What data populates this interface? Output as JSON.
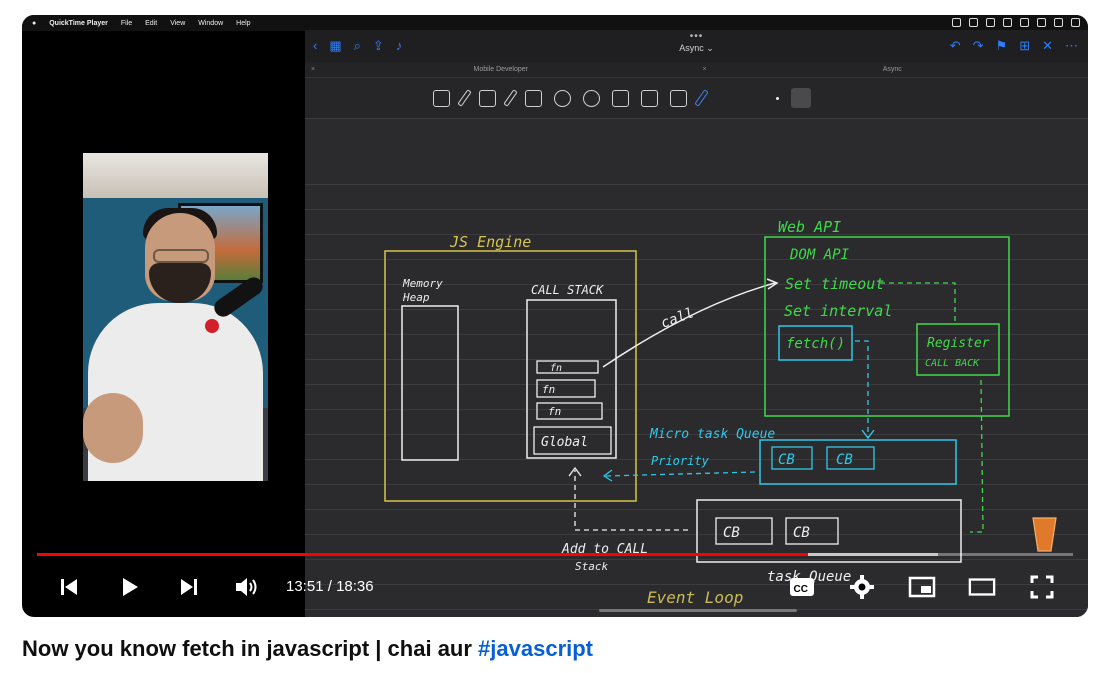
{
  "menubar": {
    "app_name": "QuickTime Player",
    "items": [
      "File",
      "Edit",
      "View",
      "Window",
      "Help"
    ]
  },
  "ipad": {
    "doc_title": "Async ⌄",
    "tabs": [
      "Mobile Developer",
      "Async"
    ]
  },
  "diagram": {
    "js_engine": "JS Engine",
    "memory_heap": [
      "Memory",
      "Heap"
    ],
    "call_stack": "CALL STACK",
    "stack_items": [
      "fn",
      "fn",
      "fn",
      "Global"
    ],
    "call_label": "call",
    "web_api": "Web API",
    "dom_api": "DOM API",
    "set_timeout": "Set timeout",
    "set_interval": "Set interval",
    "fetch": "fetch()",
    "register": [
      "Register",
      "CALL BACK"
    ],
    "micro_queue": "Micro task Queue",
    "priority": "Priority",
    "cb": "CB",
    "add_to_stack": [
      "Add to CALL",
      "Stack"
    ],
    "task_queue": "task Queue",
    "event_loop": "Event Loop"
  },
  "player": {
    "time_current": "13:51",
    "time_total": "18:36",
    "progress_fraction": 0.744,
    "buffered_fraction": 0.87,
    "progress_color": "#ff0000"
  },
  "video": {
    "title_text": "Now you know fetch in javascript | chai aur ",
    "hashtag": "#javascript"
  }
}
